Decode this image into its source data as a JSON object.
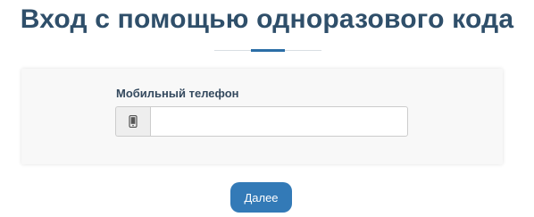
{
  "header": {
    "title": "Вход с помощью одноразового кода"
  },
  "form": {
    "phone_label": "Мобильный телефон",
    "phone_value": "",
    "phone_icon": "mobile-phone-icon"
  },
  "actions": {
    "next_label": "Далее"
  },
  "colors": {
    "title": "#2f4f6a",
    "accent": "#2b6ea6",
    "button": "#337ab7",
    "card_background": "#f8f8f8"
  }
}
